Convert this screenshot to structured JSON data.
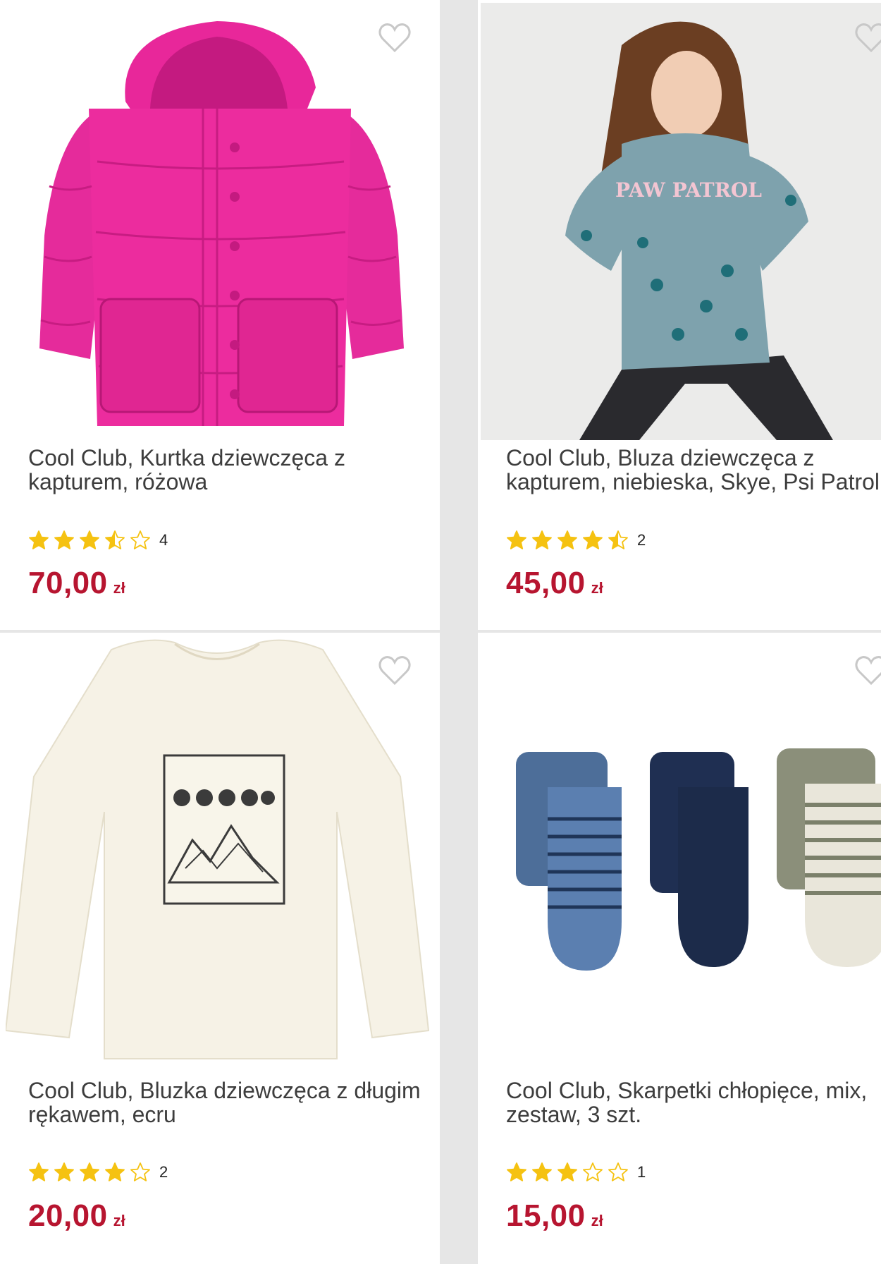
{
  "products": [
    {
      "title": "Cool Club, Kurtka dziewczęca z kapturem, różowa",
      "rating_count": "4",
      "rating_value": 3.5,
      "price": "70,00",
      "currency": "zł",
      "image_icon": "pink-puffer-jacket-image",
      "colors": {
        "main": "#e8279a",
        "dark": "#c41a80"
      }
    },
    {
      "title": "Cool Club, Bluza dziewczęca z kapturem, niebieska, Skye, Psi Patrol",
      "rating_count": "2",
      "rating_value": 4.5,
      "price": "45,00",
      "currency": "zł",
      "image_icon": "girl-in-blue-hoodie-image",
      "image_text": "PAW PATROL",
      "colors": {
        "main": "#7ea2ad",
        "dark": "#2a2a2e"
      }
    },
    {
      "title": "Cool Club, Bluzka dziewczęca z długim rękawem, ecru",
      "rating_count": "2",
      "rating_value": 4,
      "price": "20,00",
      "currency": "zł",
      "image_icon": "ecru-long-sleeve-shirt-image",
      "colors": {
        "main": "#f6f2e6",
        "dark": "#3b3b3b"
      }
    },
    {
      "title": "Cool Club, Skarpetki chłopięce, mix, zestaw, 3 szt.",
      "rating_count": "1",
      "rating_value": 3,
      "price": "15,00",
      "currency": "zł",
      "image_icon": "three-pairs-socks-image",
      "colors": {
        "main": "#4d6e99",
        "dark": "#1c2b4a"
      }
    }
  ],
  "theme": {
    "price_color": "#b71530",
    "star_color": "#f5c211"
  }
}
